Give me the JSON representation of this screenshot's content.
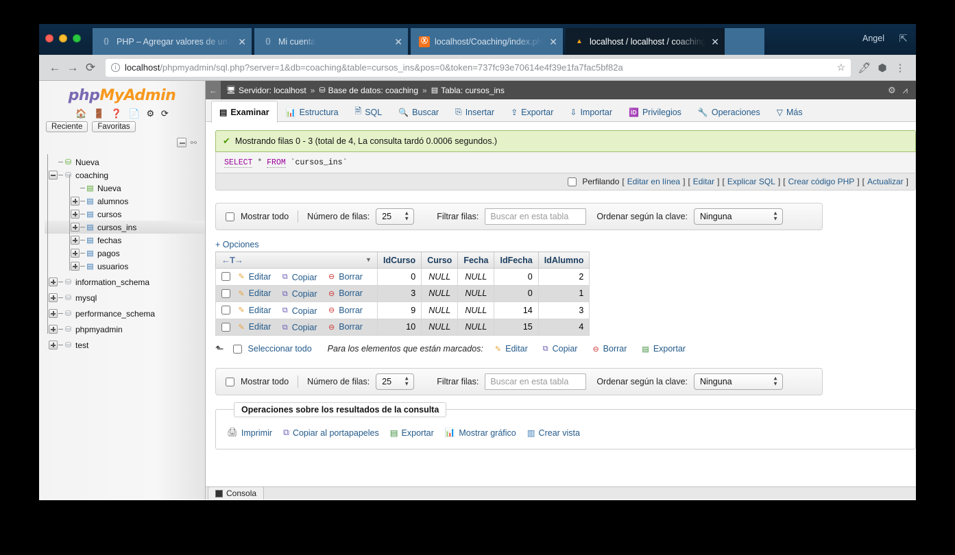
{
  "browser": {
    "tabs": [
      {
        "title": "PHP – Agregar valores de un c",
        "favicon": "code-favicon",
        "active": false
      },
      {
        "title": "Mi cuenta",
        "favicon": "code-favicon",
        "active": false
      },
      {
        "title": "localhost/Coaching/index.php",
        "favicon": "xampp-favicon",
        "active": false
      },
      {
        "title": "localhost / localhost / coaching",
        "favicon": "phpmyadmin-favicon",
        "active": true
      }
    ],
    "close_glyph": "✕",
    "user_label": "Angel",
    "address": {
      "host": "localhost",
      "path": "/phpmyadmin/sql.php?server=1&db=coaching&table=cursos_ins&pos=0&token=737fc93e70614e4f39e1fa7fac5bf82a",
      "full": "localhost/phpmyadmin/sql.php?server=1&db=coaching&table=cursos_ins&pos=0&token=737fc93e70614e4f39e1fa7fac5bf82a"
    },
    "nav": {
      "back": "←",
      "forward": "→",
      "reload": "⟳",
      "star": "☆",
      "menu": "⋮"
    }
  },
  "sidebar": {
    "logo_part1": "php",
    "logo_part2": "MyAdmin",
    "quick_icons": [
      "home-icon",
      "logout-icon",
      "help-icon",
      "docs-icon",
      "settings-icon",
      "reload-icon"
    ],
    "chips": [
      {
        "label": "Reciente"
      },
      {
        "label": "Favoritas"
      }
    ],
    "tree": [
      {
        "label": "Nueva",
        "level": 1,
        "icon": "new-database-icon",
        "expander": "none",
        "selected": false
      },
      {
        "label": "coaching",
        "level": 1,
        "icon": "database-icon",
        "expander": "minus",
        "selected": false
      },
      {
        "label": "Nueva",
        "level": 2,
        "icon": "new-table-icon",
        "expander": "none",
        "selected": false
      },
      {
        "label": "alumnos",
        "level": 2,
        "icon": "table-icon",
        "expander": "plus",
        "selected": false
      },
      {
        "label": "cursos",
        "level": 2,
        "icon": "table-icon",
        "expander": "plus",
        "selected": false
      },
      {
        "label": "cursos_ins",
        "level": 2,
        "icon": "table-icon",
        "expander": "plus",
        "selected": true
      },
      {
        "label": "fechas",
        "level": 2,
        "icon": "table-icon",
        "expander": "plus",
        "selected": false
      },
      {
        "label": "pagos",
        "level": 2,
        "icon": "table-icon",
        "expander": "plus",
        "selected": false
      },
      {
        "label": "usuarios",
        "level": 2,
        "icon": "table-icon",
        "expander": "plus",
        "selected": false
      },
      {
        "label": "information_schema",
        "level": 0,
        "icon": "database-icon",
        "expander": "plus",
        "selected": false
      },
      {
        "label": "mysql",
        "level": 0,
        "icon": "database-icon",
        "expander": "plus",
        "selected": false
      },
      {
        "label": "performance_schema",
        "level": 0,
        "icon": "database-icon",
        "expander": "plus",
        "selected": false
      },
      {
        "label": "phpmyadmin",
        "level": 0,
        "icon": "database-icon",
        "expander": "plus",
        "selected": false
      },
      {
        "label": "test",
        "level": 0,
        "icon": "database-icon",
        "expander": "plus",
        "selected": false
      }
    ]
  },
  "breadcrumb": {
    "back_glyph": "←",
    "server": "Servidor: localhost",
    "database": "Base de datos: coaching",
    "table": "Tabla: cursos_ins",
    "separator": "»",
    "settings_icon": "gear-icon",
    "collapse_icon": "collapse-icon"
  },
  "main_tabs": [
    {
      "label": "Examinar",
      "icon": "browse-icon",
      "active": true
    },
    {
      "label": "Estructura",
      "icon": "structure-icon",
      "active": false
    },
    {
      "label": "SQL",
      "icon": "sql-icon",
      "active": false
    },
    {
      "label": "Buscar",
      "icon": "search-icon",
      "active": false
    },
    {
      "label": "Insertar",
      "icon": "insert-icon",
      "active": false
    },
    {
      "label": "Exportar",
      "icon": "export-icon",
      "active": false
    },
    {
      "label": "Importar",
      "icon": "import-icon",
      "active": false
    },
    {
      "label": "Privilegios",
      "icon": "privileges-icon",
      "active": false
    },
    {
      "label": "Operaciones",
      "icon": "operations-icon",
      "active": false
    },
    {
      "label": "Más",
      "icon": "more-icon",
      "active": false
    }
  ],
  "result_message": "Mostrando filas 0 - 3 (total de 4, La consulta tardó 0.0006 segundos.)",
  "sql_query": {
    "keyword": "SELECT",
    "star": "*",
    "from": "FROM",
    "table": "`cursos_ins`"
  },
  "sql_actions": {
    "profiling_label": "Perfilando",
    "links": [
      "Editar en línea",
      "Editar",
      "Explicar SQL",
      "Crear código PHP",
      "Actualizar"
    ],
    "open_bracket": "[",
    "close_bracket": "]"
  },
  "options_bar": {
    "show_all_label": "Mostrar todo",
    "rows_label": "Número de filas:",
    "rows_value": "25",
    "filter_label": "Filtrar filas:",
    "filter_placeholder": "Buscar en esta tabla",
    "filter_value": "",
    "sort_label": "Ordenar según la clave:",
    "sort_value": "Ninguna"
  },
  "options_link": "+ Opciones",
  "table": {
    "nav_arrows": "←T→",
    "sort_caret": "▼",
    "columns": [
      "IdCurso",
      "Curso",
      "Fecha",
      "IdFecha",
      "IdAlumno"
    ],
    "row_actions": [
      {
        "label": "Editar",
        "icon": "pencil-icon"
      },
      {
        "label": "Copiar",
        "icon": "copy-icon"
      },
      {
        "label": "Borrar",
        "icon": "delete-icon"
      }
    ],
    "rows": [
      {
        "IdCurso": "0",
        "Curso": "NULL",
        "Fecha": "NULL",
        "IdFecha": "0",
        "IdAlumno": "2"
      },
      {
        "IdCurso": "3",
        "Curso": "NULL",
        "Fecha": "NULL",
        "IdFecha": "0",
        "IdAlumno": "1"
      },
      {
        "IdCurso": "9",
        "Curso": "NULL",
        "Fecha": "NULL",
        "IdFecha": "14",
        "IdAlumno": "3"
      },
      {
        "IdCurso": "10",
        "Curso": "NULL",
        "Fecha": "NULL",
        "IdFecha": "15",
        "IdAlumno": "4"
      }
    ]
  },
  "bulk": {
    "up_arrow": "⬑",
    "select_all_label": "Seleccionar todo",
    "marked_label": "Para los elementos que están marcados:",
    "actions": [
      {
        "label": "Editar",
        "icon": "pencil-icon"
      },
      {
        "label": "Copiar",
        "icon": "copy-icon"
      },
      {
        "label": "Borrar",
        "icon": "delete-icon"
      },
      {
        "label": "Exportar",
        "icon": "export-icon"
      }
    ]
  },
  "query_results": {
    "title": "Operaciones sobre los resultados de la consulta",
    "links": [
      {
        "label": "Imprimir",
        "icon": "print-icon"
      },
      {
        "label": "Copiar al portapapeles",
        "icon": "copy-icon"
      },
      {
        "label": "Exportar",
        "icon": "export-icon"
      },
      {
        "label": "Mostrar gráfico",
        "icon": "chart-icon"
      },
      {
        "label": "Crear vista",
        "icon": "create-view-icon"
      }
    ]
  },
  "console": {
    "label": "Consola"
  },
  "colors": {
    "accent_link": "#235a8a",
    "alert_bg": "#e5f2c9",
    "alert_border": "#a0c070",
    "tabbar_bg": "#0d2b47",
    "breadcrumb_bg": "#4c4c4c",
    "logo_purple": "#7a69b3",
    "logo_orange": "#f7981d"
  }
}
